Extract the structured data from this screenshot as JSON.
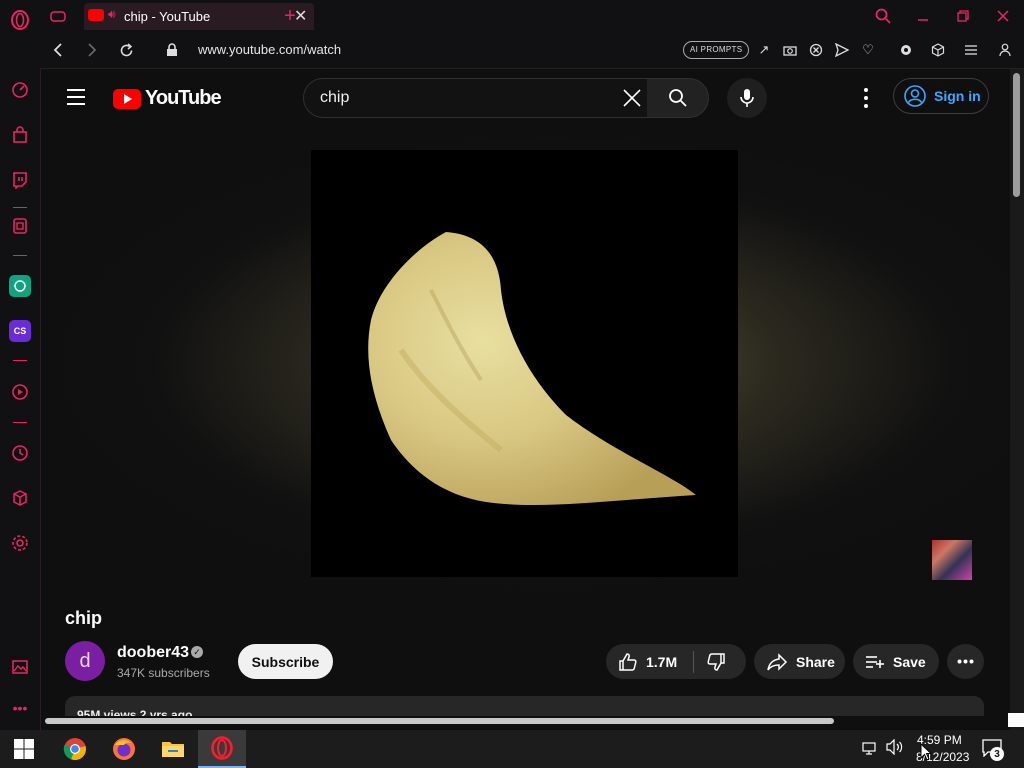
{
  "browser": {
    "tab_title": "chip - YouTube",
    "url": "www.youtube.com/watch",
    "ai_prompts": "AI PROMPTS"
  },
  "youtube": {
    "logo_text": "YouTube",
    "search_value": "chip",
    "sign_in": "Sign in"
  },
  "video": {
    "title": "chip",
    "channel_initial": "d",
    "channel_name": "doober43",
    "subscribers": "347K subscribers",
    "subscribe_label": "Subscribe",
    "likes": "1.7M",
    "share_label": "Share",
    "save_label": "Save",
    "description_preview": "95M views 2 yrs ago"
  },
  "taskbar": {
    "time": "4:59 PM",
    "date": "8/12/2023",
    "notifications": "3"
  },
  "colors": {
    "opera_accent": "#e8265e",
    "youtube_red": "#ff0000",
    "link_blue": "#3ea6ff"
  }
}
